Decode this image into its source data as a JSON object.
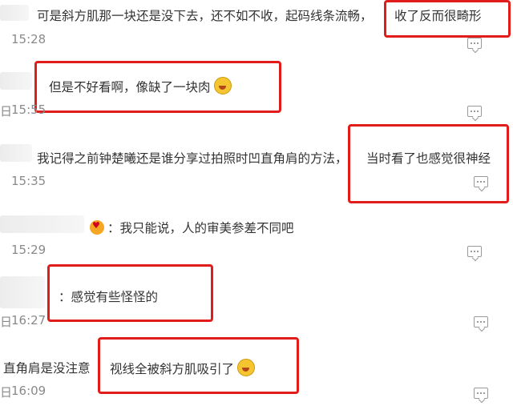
{
  "comments": [
    {
      "text": "可是斜方肌那一块还是没下去，还不如不收，起码线条流畅，",
      "highlight": "收了反而很畸形",
      "time": "15:28",
      "prefix": ""
    },
    {
      "text": "",
      "highlight": "但是不好看啊，像缺了一块肉",
      "time": "15:55",
      "prefix": "日"
    },
    {
      "text": "我记得之前钟楚曦还是谁分享过拍照时凹直角肩的方法，",
      "highlight": "当时看了也感觉很神经",
      "time": "15:35",
      "prefix": ""
    },
    {
      "text": "：我只能说，人的审美参差不同吧",
      "highlight": "",
      "time": "15:29",
      "prefix": ""
    },
    {
      "text": "",
      "highlight": "：感觉有些怪怪的",
      "time": "16:27",
      "prefix": "日"
    },
    {
      "text": "直角肩是没注意",
      "highlight": "视线全被斜方肌吸引了",
      "time": "16:09",
      "prefix": "日"
    }
  ],
  "icons": {
    "comment": "comment-icon",
    "emoji_laugh": "laugh-cry-emoji",
    "emoji_heart": "heart-face-emoji"
  },
  "colors": {
    "highlight_box": "#e21b1b",
    "time": "#8a8a8a"
  }
}
